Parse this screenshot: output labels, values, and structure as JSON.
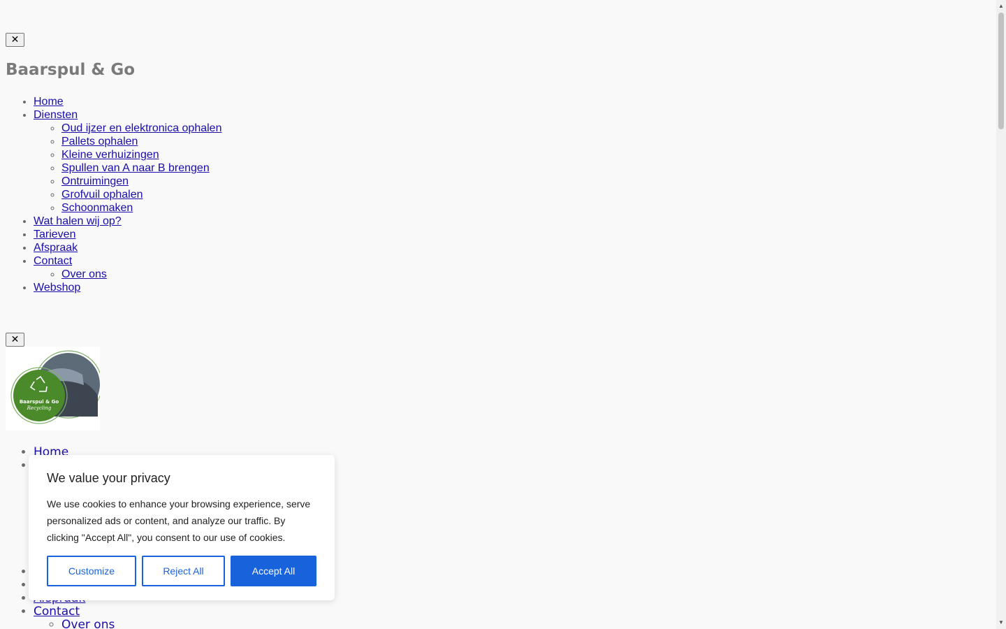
{
  "close_label": "✕",
  "site_title": "Baarspul & Go",
  "nav": {
    "home": "Home",
    "diensten": "Diensten",
    "diensten_items": [
      "Oud ijzer en elektronica ophalen",
      "Pallets ophalen",
      "Kleine verhuizingen",
      "Spullen van A naar B brengen",
      "Ontruimingen",
      "Grofvuil ophalen",
      "Schoonmaken"
    ],
    "wat_halen": "Wat halen wij op?",
    "tarieven": "Tarieven",
    "afspraak": "Afspraak",
    "contact": "Contact",
    "over_ons": "Over ons",
    "webshop": "Webshop"
  },
  "logo": {
    "line1": "Baarspul & Go",
    "line2": "Recycling"
  },
  "cookie": {
    "title": "We value your privacy",
    "text": "We use cookies to enhance your browsing experience, serve personalized ads or content, and analyze our traffic. By clicking \"Accept All\", you consent to our use of cookies.",
    "customize": "Customize",
    "reject": "Reject All",
    "accept": "Accept All"
  },
  "colors": {
    "link": "#1a0dab",
    "accent": "#1863dc",
    "logo_green": "#4a8a2a"
  }
}
